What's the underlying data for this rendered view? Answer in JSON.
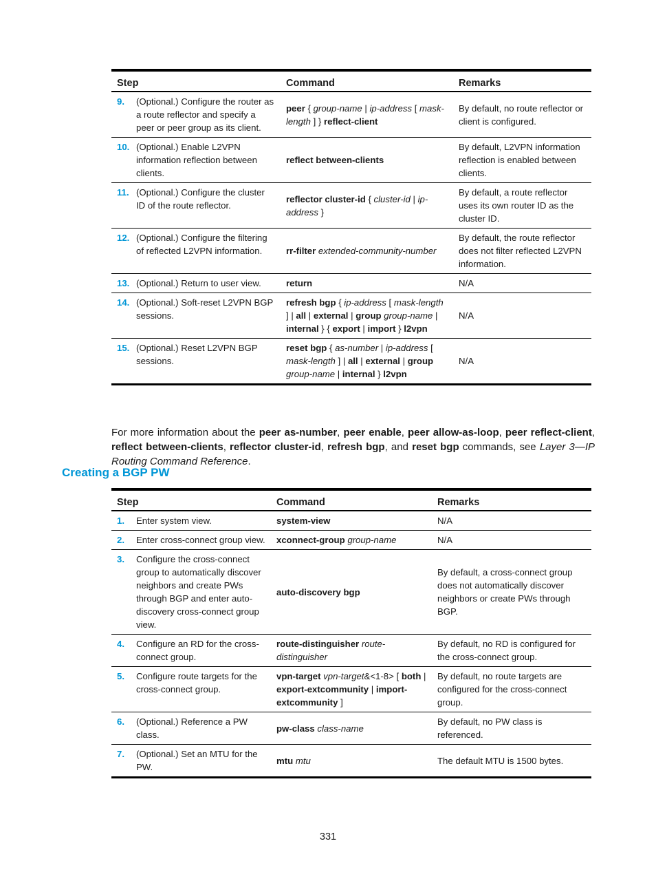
{
  "table1": {
    "headers": {
      "step": "Step",
      "command": "Command",
      "remarks": "Remarks"
    },
    "rows": [
      {
        "num": "9.",
        "desc": "(Optional.) Configure the router as a route reflector and specify a peer or peer group as its client.",
        "cmd": [
          {
            "t": "peer",
            "s": "b"
          },
          {
            "t": " { "
          },
          {
            "t": "group-name",
            "s": "i"
          },
          {
            "t": " | "
          },
          {
            "t": "ip-address",
            "s": "i"
          },
          {
            "t": " [ "
          },
          {
            "t": "mask-length",
            "s": "i"
          },
          {
            "t": " ] } "
          },
          {
            "t": "reflect-client",
            "s": "b"
          }
        ],
        "remarks": "By default, no route reflector or client is configured."
      },
      {
        "num": "10.",
        "desc": "(Optional.) Enable L2VPN information reflection between clients.",
        "cmd": [
          {
            "t": "reflect between-clients",
            "s": "b"
          }
        ],
        "remarks": "By default, L2VPN information reflection is enabled between clients."
      },
      {
        "num": "11.",
        "desc": "(Optional.) Configure the cluster ID of the route reflector.",
        "cmd": [
          {
            "t": "reflector cluster-id",
            "s": "b"
          },
          {
            "t": " { "
          },
          {
            "t": "cluster-id",
            "s": "i"
          },
          {
            "t": " | "
          },
          {
            "t": "ip-address",
            "s": "i"
          },
          {
            "t": " }"
          }
        ],
        "remarks": "By default, a route reflector uses its own router ID as the cluster ID."
      },
      {
        "num": "12.",
        "desc": "(Optional.) Configure the filtering of reflected L2VPN information.",
        "cmd": [
          {
            "t": "rr-filter",
            "s": "b"
          },
          {
            "t": " "
          },
          {
            "t": "extended-community-number",
            "s": "i"
          }
        ],
        "remarks": "By default, the route reflector does not filter reflected L2VPN information."
      },
      {
        "num": "13.",
        "desc": "(Optional.) Return to user view.",
        "cmd": [
          {
            "t": "return",
            "s": "b"
          }
        ],
        "remarks": "N/A"
      },
      {
        "num": "14.",
        "desc": "(Optional.) Soft-reset L2VPN BGP sessions.",
        "cmd": [
          {
            "t": "refresh bgp",
            "s": "b"
          },
          {
            "t": " { "
          },
          {
            "t": "ip-address",
            "s": "i"
          },
          {
            "t": " [ "
          },
          {
            "t": "mask-length",
            "s": "i"
          },
          {
            "t": " ] | "
          },
          {
            "t": "all",
            "s": "b"
          },
          {
            "t": " | "
          },
          {
            "t": "external",
            "s": "b"
          },
          {
            "t": " | "
          },
          {
            "t": "group",
            "s": "b"
          },
          {
            "t": " "
          },
          {
            "t": "group-name",
            "s": "i"
          },
          {
            "t": " | "
          },
          {
            "t": "internal",
            "s": "b"
          },
          {
            "t": " } { "
          },
          {
            "t": "export",
            "s": "b"
          },
          {
            "t": " | "
          },
          {
            "t": "import",
            "s": "b"
          },
          {
            "t": " } "
          },
          {
            "t": "l2vpn",
            "s": "b"
          }
        ],
        "remarks": "N/A"
      },
      {
        "num": "15.",
        "desc": "(Optional.) Reset L2VPN BGP sessions.",
        "cmd": [
          {
            "t": "reset bgp",
            "s": "b"
          },
          {
            "t": " { "
          },
          {
            "t": "as-number",
            "s": "i"
          },
          {
            "t": " | "
          },
          {
            "t": "ip-address",
            "s": "i"
          },
          {
            "t": " [ "
          },
          {
            "t": "mask-length",
            "s": "i"
          },
          {
            "t": " ] | "
          },
          {
            "t": "all",
            "s": "b"
          },
          {
            "t": " | "
          },
          {
            "t": "external",
            "s": "b"
          },
          {
            "t": " | "
          },
          {
            "t": "group",
            "s": "b"
          },
          {
            "t": " "
          },
          {
            "t": "group-name",
            "s": "i"
          },
          {
            "t": " | "
          },
          {
            "t": "internal",
            "s": "b"
          },
          {
            "t": " } "
          },
          {
            "t": "l2vpn",
            "s": "b"
          }
        ],
        "remarks": "N/A"
      }
    ]
  },
  "paragraph": [
    {
      "t": "For more information about the "
    },
    {
      "t": "peer as-number",
      "s": "b"
    },
    {
      "t": ", "
    },
    {
      "t": "peer enable",
      "s": "b"
    },
    {
      "t": ", "
    },
    {
      "t": "peer allow-as-loop",
      "s": "b"
    },
    {
      "t": ", "
    },
    {
      "t": "peer reflect-client",
      "s": "b"
    },
    {
      "t": ", "
    },
    {
      "t": "reflect between-clients",
      "s": "b"
    },
    {
      "t": ", "
    },
    {
      "t": "reflector cluster-id",
      "s": "b"
    },
    {
      "t": ", "
    },
    {
      "t": "refresh bgp",
      "s": "b"
    },
    {
      "t": ", and "
    },
    {
      "t": "reset bgp",
      "s": "b"
    },
    {
      "t": " commands, see "
    },
    {
      "t": "Layer 3—IP Routing Command Reference",
      "s": "i"
    },
    {
      "t": "."
    }
  ],
  "section_heading": "Creating a BGP PW",
  "table2": {
    "headers": {
      "step": "Step",
      "command": "Command",
      "remarks": "Remarks"
    },
    "rows": [
      {
        "num": "1.",
        "desc": "Enter system view.",
        "cmd": [
          {
            "t": "system-view",
            "s": "b"
          }
        ],
        "remarks": "N/A"
      },
      {
        "num": "2.",
        "desc": "Enter cross-connect group view.",
        "cmd": [
          {
            "t": "xconnect-group",
            "s": "b"
          },
          {
            "t": " "
          },
          {
            "t": "group-name",
            "s": "i"
          }
        ],
        "remarks": "N/A"
      },
      {
        "num": "3.",
        "desc": "Configure the cross-connect group to automatically discover neighbors and create PWs through BGP and enter auto-discovery cross-connect group view.",
        "cmd": [
          {
            "t": "auto-discovery bgp",
            "s": "b"
          }
        ],
        "remarks": "By default, a cross-connect group does not automatically discover neighbors or create PWs through BGP."
      },
      {
        "num": "4.",
        "desc": "Configure an RD for the cross-connect group.",
        "cmd": [
          {
            "t": "route-distinguisher",
            "s": "b"
          },
          {
            "t": " "
          },
          {
            "t": "route-distinguisher",
            "s": "i"
          }
        ],
        "remarks": "By default, no RD is configured for the cross-connect group."
      },
      {
        "num": "5.",
        "desc": "Configure route targets for the cross-connect group.",
        "cmd": [
          {
            "t": "vpn-target",
            "s": "b"
          },
          {
            "t": " "
          },
          {
            "t": "vpn-target",
            "s": "i"
          },
          {
            "t": "&<1-8> [ "
          },
          {
            "t": "both",
            "s": "b"
          },
          {
            "t": " | "
          },
          {
            "t": "export-extcommunity",
            "s": "b"
          },
          {
            "t": " | "
          },
          {
            "t": "import-extcommunity",
            "s": "b"
          },
          {
            "t": " ]"
          }
        ],
        "remarks": "By default, no route targets are configured for the cross-connect group."
      },
      {
        "num": "6.",
        "desc": "(Optional.) Reference a PW class.",
        "cmd": [
          {
            "t": "pw-class",
            "s": "b"
          },
          {
            "t": " "
          },
          {
            "t": "class-name",
            "s": "i"
          }
        ],
        "remarks": "By default, no PW class is referenced."
      },
      {
        "num": "7.",
        "desc": "(Optional.) Set an MTU for the PW.",
        "cmd": [
          {
            "t": "mtu",
            "s": "b"
          },
          {
            "t": " "
          },
          {
            "t": "mtu",
            "s": "i"
          }
        ],
        "remarks": "The default MTU is 1500 bytes."
      }
    ]
  },
  "page_number": "331"
}
